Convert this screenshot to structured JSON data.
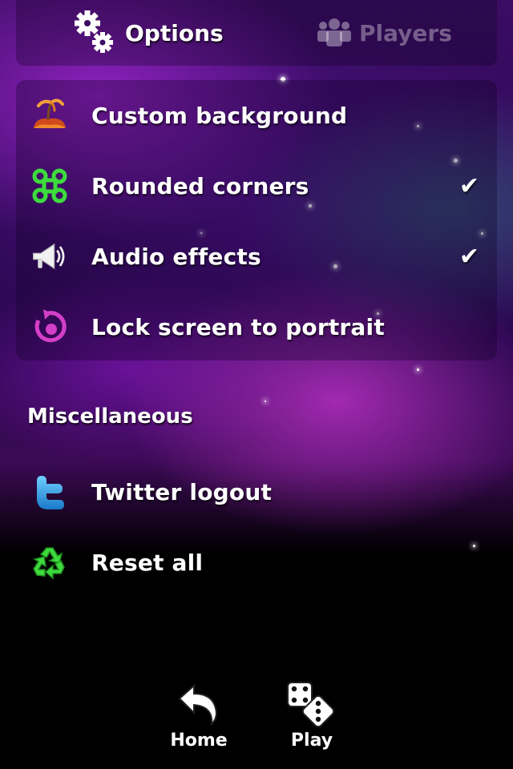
{
  "tabs": {
    "options": {
      "label": "Options",
      "icon": "gears-icon",
      "active": true
    },
    "players": {
      "label": "Players",
      "icon": "people-icon",
      "active": false
    }
  },
  "options": [
    {
      "label": "Custom background",
      "icon": "island-icon",
      "checked": false
    },
    {
      "label": "Rounded corners",
      "icon": "command-key-icon",
      "checked": true
    },
    {
      "label": "Audio effects",
      "icon": "megaphone-icon",
      "checked": true
    },
    {
      "label": "Lock screen to portrait",
      "icon": "rotate-lock-icon",
      "checked": false
    }
  ],
  "check_glyph": "✔",
  "miscellaneous": {
    "title": "Miscellaneous",
    "items": [
      {
        "label": "Twitter logout",
        "icon": "twitter-icon"
      },
      {
        "label": "Reset all",
        "icon": "recycle-icon"
      }
    ]
  },
  "toolbar": {
    "home_label": "Home",
    "play_label": "Play"
  },
  "colors": {
    "accent_green": "#3ddc3d",
    "accent_magenta": "#d43fc8",
    "twitter_blue": "#2aa7e8"
  }
}
